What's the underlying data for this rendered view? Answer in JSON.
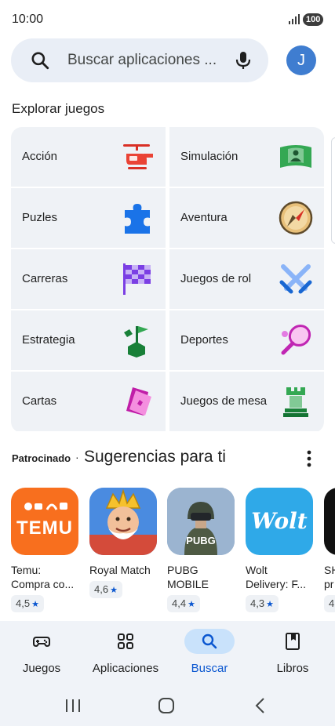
{
  "status_bar": {
    "time": "10:00",
    "battery": "100"
  },
  "search": {
    "placeholder": "Buscar aplicaciones ..."
  },
  "account": {
    "initial": "J"
  },
  "explore": {
    "title": "Explorar juegos",
    "categories": [
      {
        "label": "Acción",
        "icon": "helicopter-icon"
      },
      {
        "label": "Simulación",
        "icon": "simulation-icon"
      },
      {
        "label": "Puzles",
        "icon": "puzzle-icon"
      },
      {
        "label": "Aventura",
        "icon": "compass-icon"
      },
      {
        "label": "Carreras",
        "icon": "checkered-flag-icon"
      },
      {
        "label": "Juegos de rol",
        "icon": "crossed-swords-icon"
      },
      {
        "label": "Estrategia",
        "icon": "strategy-flag-icon"
      },
      {
        "label": "Deportes",
        "icon": "tennis-racket-icon"
      },
      {
        "label": "Cartas",
        "icon": "cards-icon"
      },
      {
        "label": "Juegos de mesa",
        "icon": "chess-rook-icon"
      }
    ]
  },
  "suggestions": {
    "sponsored": "Patrocinado",
    "separator": "·",
    "title": "Sugerencias para ti",
    "apps": [
      {
        "line1": "Temu:",
        "line2": "Compra co...",
        "rating": "4,5",
        "icon_text": "TEMU"
      },
      {
        "line1": "Royal Match",
        "line2": "",
        "rating": "4,6",
        "icon_text": ""
      },
      {
        "line1": "PUBG",
        "line2": "MOBILE",
        "rating": "4,4",
        "icon_text": "PUBG"
      },
      {
        "line1": "Wolt",
        "line2": "Delivery: F...",
        "rating": "4,3",
        "icon_text": "Wolt"
      },
      {
        "line1": "SH",
        "line2": "pr",
        "rating": "4",
        "icon_text": ""
      }
    ]
  },
  "bottom_nav": {
    "items": [
      {
        "label": "Juegos",
        "icon": "gamepad-icon"
      },
      {
        "label": "Aplicaciones",
        "icon": "apps-grid-icon"
      },
      {
        "label": "Buscar",
        "icon": "search-icon",
        "active": true
      },
      {
        "label": "Libros",
        "icon": "book-icon"
      }
    ]
  },
  "colors": {
    "accent": "#0b57d0",
    "active_pill": "#c9e2fb",
    "tile_bg": "#eff2f6",
    "search_bg": "#e9eef6"
  }
}
